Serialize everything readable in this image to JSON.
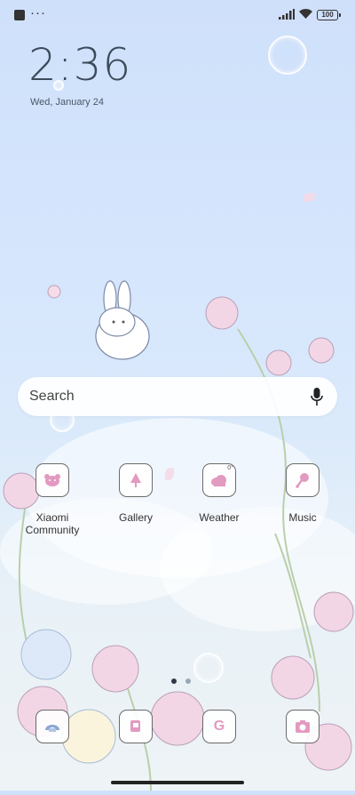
{
  "status_bar": {
    "battery_level": "100"
  },
  "lockscreen": {
    "time": "2:36",
    "date": "Wed, January 24"
  },
  "search": {
    "label": "Search"
  },
  "apps": [
    {
      "label": "Xiaomi Community",
      "icon": "bear-icon"
    },
    {
      "label": "Gallery",
      "icon": "tree-icon"
    },
    {
      "label": "Weather",
      "icon": "cloud-icon",
      "badge": "0°"
    },
    {
      "label": "Music",
      "icon": "music-note-icon"
    }
  ],
  "dock": [
    {
      "icon": "phone-icon"
    },
    {
      "icon": "messages-icon"
    },
    {
      "icon": "google-icon",
      "glyph": "G"
    },
    {
      "icon": "camera-icon"
    }
  ],
  "page_indicator": {
    "pages": 2,
    "current": 1
  },
  "colors": {
    "accent_pink": "#e39ac0",
    "text_dark": "#3c4b5a"
  }
}
